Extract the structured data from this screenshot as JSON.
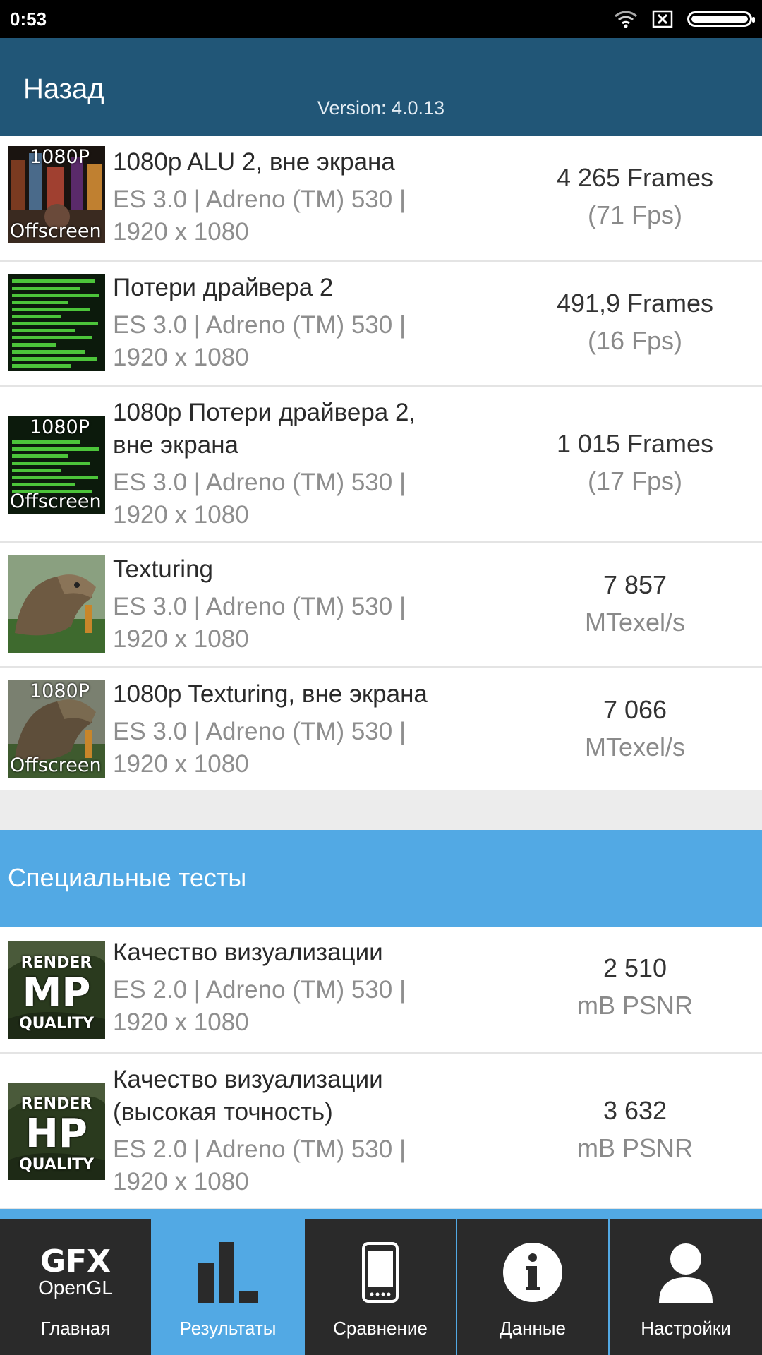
{
  "status_bar": {
    "time": "0:53",
    "icons": [
      "wifi-icon",
      "sim-x-icon",
      "battery-icon"
    ]
  },
  "header": {
    "back_label": "Назад",
    "version": "Version: 4.0.13"
  },
  "results": [
    {
      "title": "1080p ALU 2, вне экрана",
      "sub1": "ES 3.0 | Adreno (TM) 530 |",
      "sub2": "1920 x 1080",
      "score": "4 265 Frames",
      "unit": "(71 Fps)",
      "thumb": {
        "type": "alu",
        "top": "1080P",
        "bottom": "Offscreen"
      }
    },
    {
      "title": "Потери драйвера 2",
      "sub1": "ES 3.0 | Adreno (TM) 530 |",
      "sub2": "1920 x 1080",
      "score": "491,9 Frames",
      "unit": "(16 Fps)",
      "thumb": {
        "type": "bars"
      }
    },
    {
      "title": "1080p Потери драйвера 2,",
      "title2": "вне экрана",
      "sub1": "ES 3.0 | Adreno (TM) 530 |",
      "sub2": "1920 x 1080",
      "score": "1 015 Frames",
      "unit": "(17 Fps)",
      "thumb": {
        "type": "bars",
        "top": "1080P",
        "bottom": "Offscreen"
      }
    },
    {
      "title": "Texturing",
      "sub1": "ES 3.0 | Adreno (TM) 530 |",
      "sub2": "1920 x 1080",
      "score": "7 857",
      "unit": "MTexel/s",
      "thumb": {
        "type": "dino"
      }
    },
    {
      "title": "1080p Texturing, вне экрана",
      "sub1": "ES 3.0 | Adreno (TM) 530 |",
      "sub2": "1920 x 1080",
      "score": "7 066",
      "unit": "MTexel/s",
      "thumb": {
        "type": "dino",
        "top": "1080P",
        "bottom": "Offscreen"
      }
    }
  ],
  "section_title": "Специальные тесты",
  "special": [
    {
      "title": "Качество визуализации",
      "sub1": "ES 2.0 | Adreno (TM) 530 |",
      "sub2": "1920 x 1080",
      "score": "2 510",
      "unit": "mB PSNR",
      "thumb": {
        "type": "render",
        "top": "RENDER",
        "mid": "MP",
        "bottom": "QUALITY"
      }
    },
    {
      "title": "Качество визуализации",
      "title2": "(высокая точность)",
      "sub1": "ES 2.0 | Adreno (TM) 530 |",
      "sub2": "1920 x 1080",
      "score": "3 632",
      "unit": "mB PSNR",
      "thumb": {
        "type": "render",
        "top": "RENDER",
        "mid": "HP",
        "bottom": "QUALITY"
      }
    }
  ],
  "nav": [
    {
      "label": "Главная",
      "icon": "gfx-opengl-logo",
      "logo_top": "GFX",
      "logo_bottom": "OpenGL",
      "active": false
    },
    {
      "label": "Результаты",
      "icon": "bar-chart-icon",
      "active": true
    },
    {
      "label": "Сравнение",
      "icon": "phone-icon",
      "active": false
    },
    {
      "label": "Данные",
      "icon": "info-icon",
      "active": false
    },
    {
      "label": "Настройки",
      "icon": "user-icon",
      "active": false
    }
  ]
}
